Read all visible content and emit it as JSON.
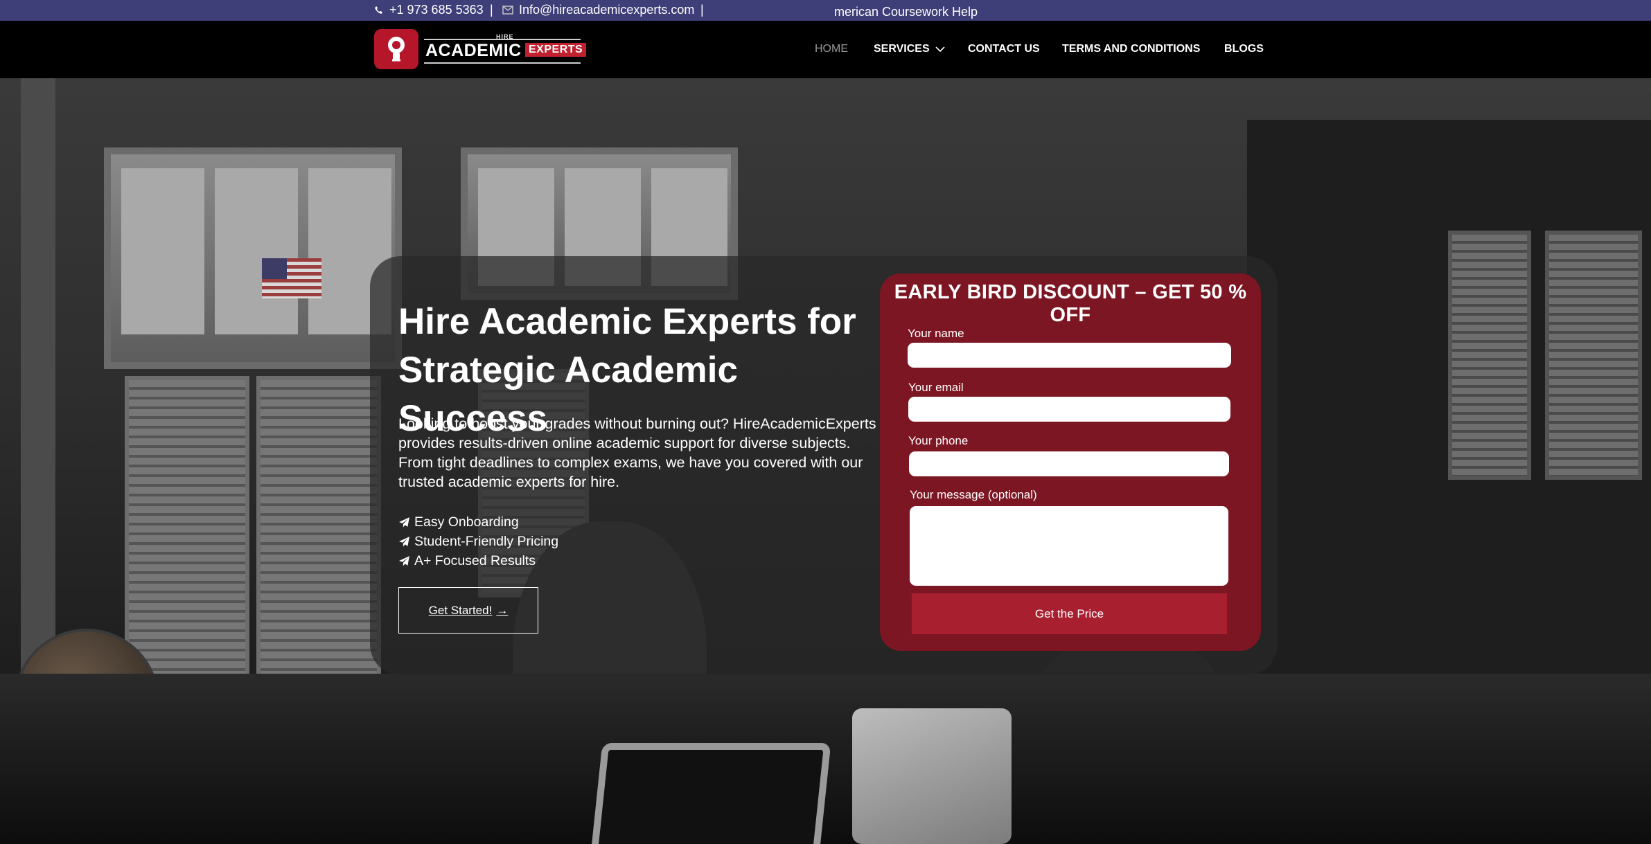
{
  "topbar": {
    "phone": "+1 973 685 5363",
    "separator": "|",
    "email": "Info@hireacademicexperts.com",
    "marquee": "merican Coursework Help"
  },
  "logo": {
    "hire": "HIRE",
    "academic": "ACADEMIC",
    "experts": "EXPERTS"
  },
  "nav": {
    "items": [
      {
        "label": "HOME"
      },
      {
        "label": "SERVICES"
      },
      {
        "label": "CONTACT US"
      },
      {
        "label": "TERMS AND CONDITIONS"
      },
      {
        "label": "BLOGS"
      }
    ]
  },
  "hero": {
    "title": "Hire Academic Experts for Strategic Academic Success",
    "description": "Looking to boost your grades without burning out? HireAcademicExperts provides results-driven online academic support for diverse subjects. From tight deadlines to complex exams, we have you covered with our trusted academic experts for hire.",
    "features": [
      "Easy Onboarding",
      "Student-Friendly Pricing",
      "A+ Focused Results"
    ],
    "cta_label": "Get Started!",
    "cta_arrow": "→"
  },
  "form": {
    "title": "EARLY BIRD DISCOUNT – GET 50 % OFF",
    "name_label": "Your name",
    "email_label": "Your email",
    "phone_label": "Your phone",
    "message_label": "Your message (optional)",
    "submit_label": "Get the Price"
  },
  "colors": {
    "topbar": "#3e3e78",
    "brand_red": "#b5162a",
    "form_bg": "#7d1623",
    "button": "#a81f30"
  }
}
